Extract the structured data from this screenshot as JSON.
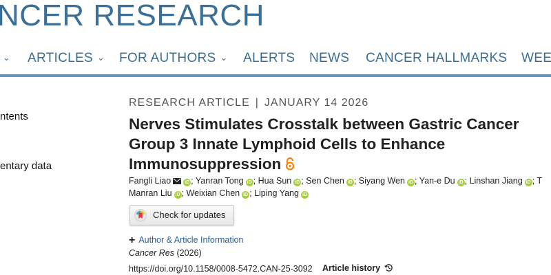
{
  "header": {
    "journal_title": "NCER RESEARCH"
  },
  "nav": {
    "items": [
      {
        "label": "",
        "has_dropdown": true
      },
      {
        "label": "ARTICLES",
        "has_dropdown": true
      },
      {
        "label": "FOR AUTHORS",
        "has_dropdown": true
      },
      {
        "label": "ALERTS",
        "has_dropdown": false
      },
      {
        "label": "NEWS",
        "has_dropdown": false
      },
      {
        "label": "CANCER HALLMARKS",
        "has_dropdown": false
      },
      {
        "label": "WEE",
        "has_dropdown": false
      }
    ],
    "chevron": "⌄"
  },
  "sidebar": {
    "items": [
      {
        "label": "ntents"
      },
      {
        "label": "entary data"
      }
    ]
  },
  "article": {
    "type": "RESEARCH ARTICLE",
    "separator": "|",
    "date": "JANUARY 14 2026",
    "title_lines": [
      "Nerves Stimulates Crosstalk between Gastric Cancer",
      "Group 3 Innate Lymphoid Cells to Enhance",
      "Immunosuppression"
    ],
    "open_access_icon": "open-access-lock-icon",
    "authors_line1": [
      {
        "name": "Fangli Liao",
        "mail": true
      },
      {
        "name": "Yanran Tong"
      },
      {
        "name": "Hua Sun"
      },
      {
        "name": "Sen Chen"
      },
      {
        "name": "Siyang Wen"
      },
      {
        "name": "Yan-e Du"
      },
      {
        "name": "Linshan Jiang"
      },
      {
        "name": "T",
        "partial": true
      }
    ],
    "authors_line2": [
      {
        "name": "Manran Liu"
      },
      {
        "name": "Weixian Chen"
      },
      {
        "name": "Liping Yang"
      }
    ],
    "orcid_glyph": "iD",
    "author_separator": ";",
    "check_updates_label": "Check for updates",
    "author_info_plus": "+",
    "author_info_label": "Author & Article Information",
    "journal_name": "Cancer Res",
    "journal_year": "(2026)",
    "doi": "https://doi.org/10.1158/0008-5472.CAN-25-3092",
    "history_label": "Article history"
  },
  "colors": {
    "brand": "#3a6f98",
    "link": "#2a5d8f",
    "orcid": "#a6ce39",
    "open_access": "#f68212"
  }
}
